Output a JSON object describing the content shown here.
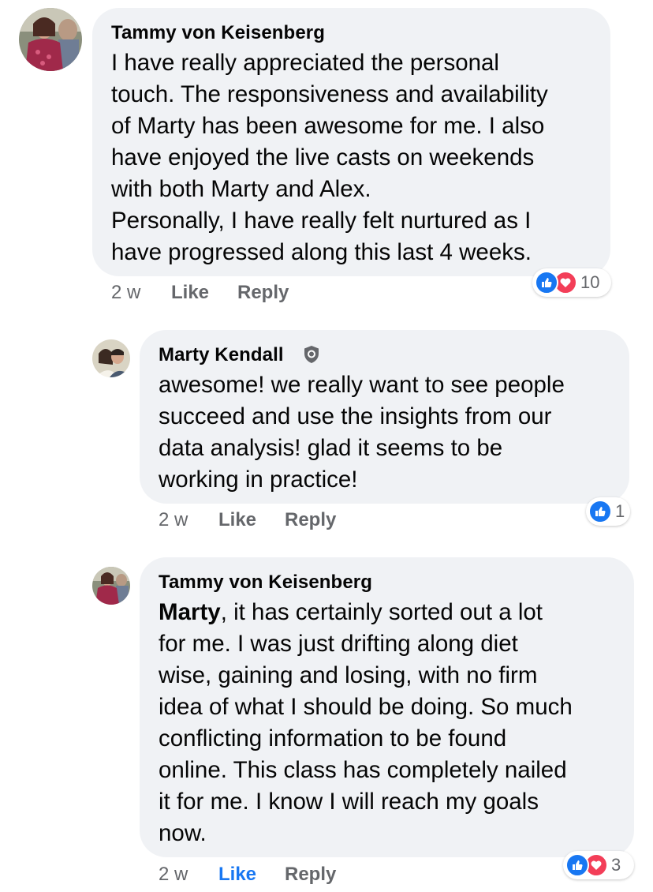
{
  "comments": [
    {
      "author": "Tammy von Keisenberg",
      "lines": [
        "I have really appreciated the personal",
        "touch. The responsiveness and availability",
        "of Marty has been awesome for me. I also",
        "have enjoyed the live casts on weekends",
        "with both Marty and Alex.",
        "Personally,  I have really felt nurtured as I",
        "have progressed along this last 4 weeks."
      ],
      "time": "2 w",
      "like_label": "Like",
      "reply_label": "Reply",
      "reaction_count": "10"
    },
    {
      "author": "Marty Kendall",
      "lines": [
        "awesome!  we really want to see people",
        "succeed and use the insights from our",
        "data analysis!  glad it seems to be",
        "working in practice!"
      ],
      "time": "2 w",
      "like_label": "Like",
      "reply_label": "Reply",
      "reaction_count": "1"
    },
    {
      "author": "Tammy von Keisenberg",
      "mention": "Marty",
      "first_line_rest": ", it has certainly sorted out a lot",
      "lines": [
        "for me. I was just drifting along diet",
        "wise, gaining and losing,  with no firm",
        "idea of what I should be doing. So much",
        "conflicting  information to be found",
        "online. This class has completely nailed",
        "it for me. I know I will reach my goals",
        "now."
      ],
      "time": "2 w",
      "like_label": "Like",
      "reply_label": "Reply",
      "reaction_count": "3"
    }
  ],
  "colors": {
    "bubble": "#f0f2f5",
    "meta": "#65676b",
    "liked": "#1877f2",
    "like_reaction": "#1877f2",
    "love_reaction": "#f33e58"
  },
  "icons": [
    "thumbs-up-icon",
    "heart-icon",
    "admin-shield-icon"
  ]
}
